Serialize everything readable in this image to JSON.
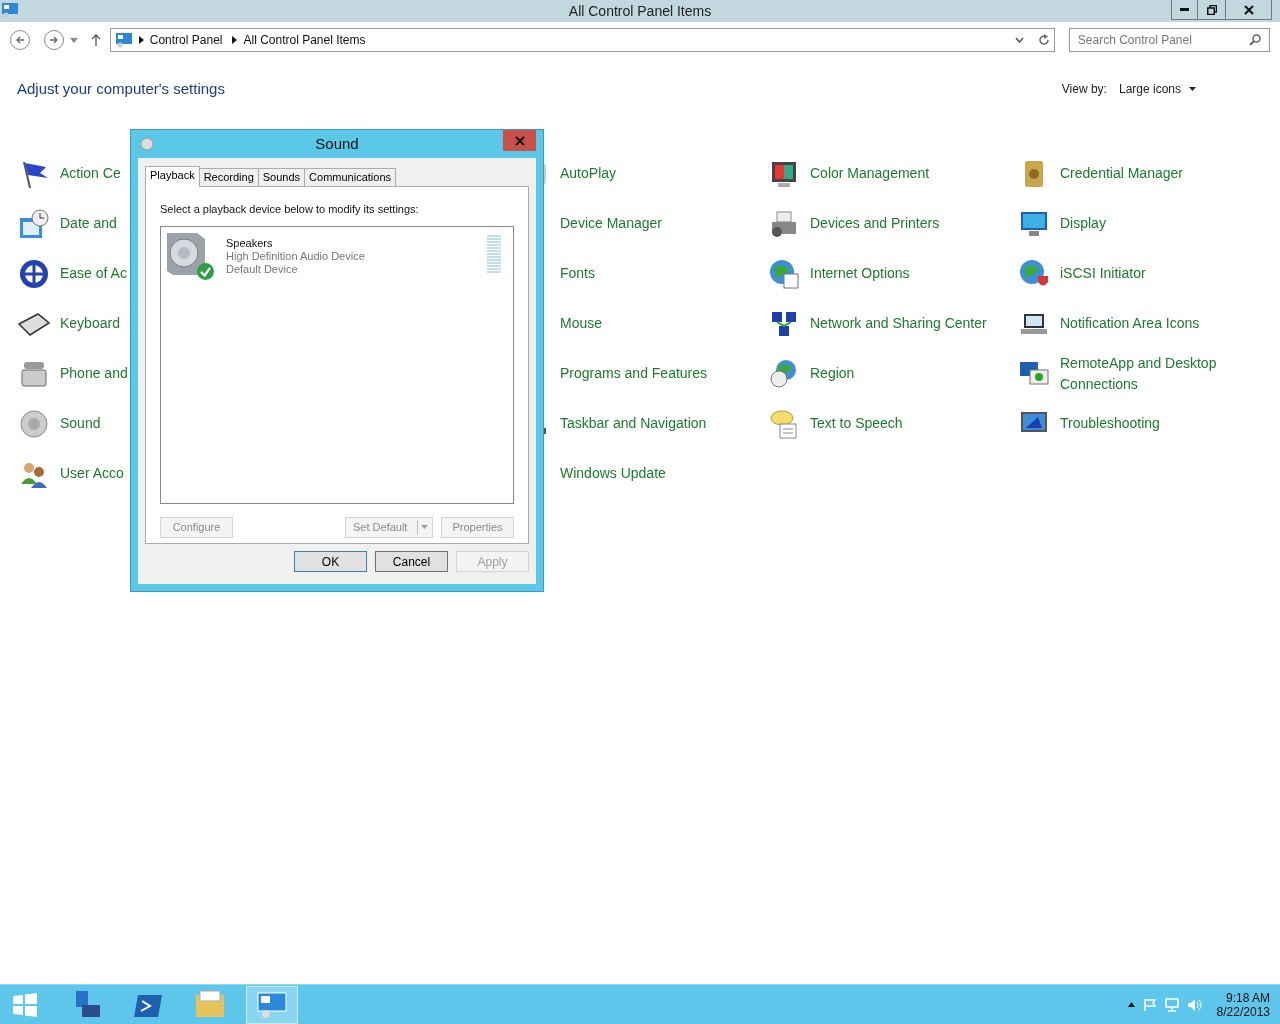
{
  "window": {
    "title": "All Control Panel Items"
  },
  "address_bar": {
    "breadcrumbs": [
      "Control Panel",
      "All Control Panel Items"
    ]
  },
  "search": {
    "placeholder": "Search Control Panel"
  },
  "heading": "Adjust your computer's settings",
  "view_by": {
    "label": "View by:",
    "value": "Large icons"
  },
  "item_rows": [
    [
      "Action Ce",
      "AutoPlay",
      "Color Management",
      "Credential Manager"
    ],
    [
      "Date and ",
      "Device Manager",
      "Devices and Printers",
      "Display"
    ],
    [
      "Ease of Ac",
      "Fonts",
      "Internet Options",
      "iSCSI Initiator"
    ],
    [
      "Keyboard",
      "Mouse",
      "Network and Sharing Center",
      "Notification Area Icons"
    ],
    [
      "Phone and",
      "Programs and Features",
      "Region",
      "RemoteApp and Desktop Connections"
    ],
    [
      "Sound",
      "Taskbar and Navigation",
      "Text to Speech",
      "Troubleshooting"
    ],
    [
      "User Acco",
      "Windows Update"
    ]
  ],
  "dialog": {
    "title": "Sound",
    "tabs": [
      {
        "label": "Playback",
        "selected": true
      },
      {
        "label": "Recording",
        "selected": false
      },
      {
        "label": "Sounds",
        "selected": false
      },
      {
        "label": "Communications",
        "selected": false
      }
    ],
    "instruction": "Select a playback device below to modify its settings:",
    "devices": [
      {
        "name": "Speakers",
        "description": "High Definition Audio Device",
        "status": "Default Device",
        "default": true
      }
    ],
    "device_buttons": [
      {
        "label": "Configure",
        "disabled": true,
        "split": false
      },
      {
        "label": "Set Default",
        "disabled": true,
        "split": true
      },
      {
        "label": "Properties",
        "disabled": true,
        "split": false
      }
    ],
    "buttons": [
      {
        "label": "OK",
        "disabled": false,
        "default": true
      },
      {
        "label": "Cancel",
        "disabled": false,
        "default": false
      },
      {
        "label": "Apply",
        "disabled": true,
        "default": false
      }
    ]
  },
  "taskbar": {
    "apps": [
      {
        "selected": false
      },
      {
        "selected": false
      },
      {
        "selected": false
      },
      {
        "selected": true
      }
    ],
    "time": "9:18 AM",
    "date": "8/22/2013"
  }
}
